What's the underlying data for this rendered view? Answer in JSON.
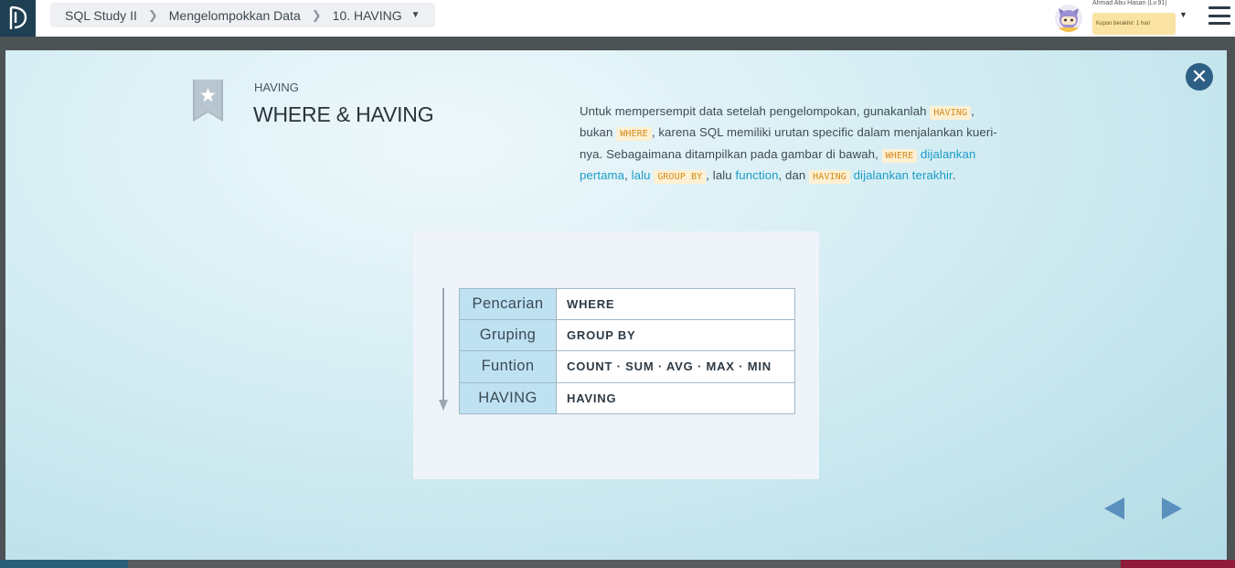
{
  "breadcrumb": {
    "course": "SQL Study II",
    "chapter": "Mengelompokkan Data",
    "lesson": "10. HAVING"
  },
  "user": {
    "name": "Ahmad Abu Hasan (Lv.91)",
    "coupon": "Kupon berakhir: 1 hari"
  },
  "slide": {
    "label": "HAVING",
    "title": "WHERE & HAVING"
  },
  "description": {
    "p1": "Untuk mempersempit data setelah pengelompokan, gunakanlah ",
    "c1": "HAVING",
    "p2": ", bukan ",
    "c2": "WHERE",
    "p3": ", karena SQL memiliki urutan specific dalam menjalankan kueri-nya. Sebagaimana ditampilkan pada gambar di bawah, ",
    "c3": "WHERE",
    "h1": "dijalankan pertama",
    "p4": ", ",
    "h2": "lalu",
    "c4": "GROUP BY",
    "p5": ", lalu ",
    "h3": "function",
    "p6": ", dan ",
    "c5": "HAVING",
    "h4": "dijalankan terakhir",
    "p7": "."
  },
  "flow": [
    {
      "stage": "Pencarian",
      "clause": "WHERE"
    },
    {
      "stage": "Gruping",
      "clause": "GROUP BY"
    },
    {
      "stage": "Funtion",
      "clause": "COUNT · SUM · AVG · MAX · MIN"
    },
    {
      "stage": "HAVING",
      "clause": "HAVING"
    }
  ],
  "icons": {
    "close": "close-icon",
    "prev": "arrow-left-icon",
    "next": "arrow-right-icon",
    "menu": "hamburger-icon",
    "bookmark": "star-bookmark-icon"
  },
  "colors": {
    "accent": "#1b9bc8",
    "code_text": "#d48b1c",
    "code_bg": "#fdf0d3",
    "stage_bg": "#bfe2f2",
    "close_bg": "#2d5f85"
  }
}
